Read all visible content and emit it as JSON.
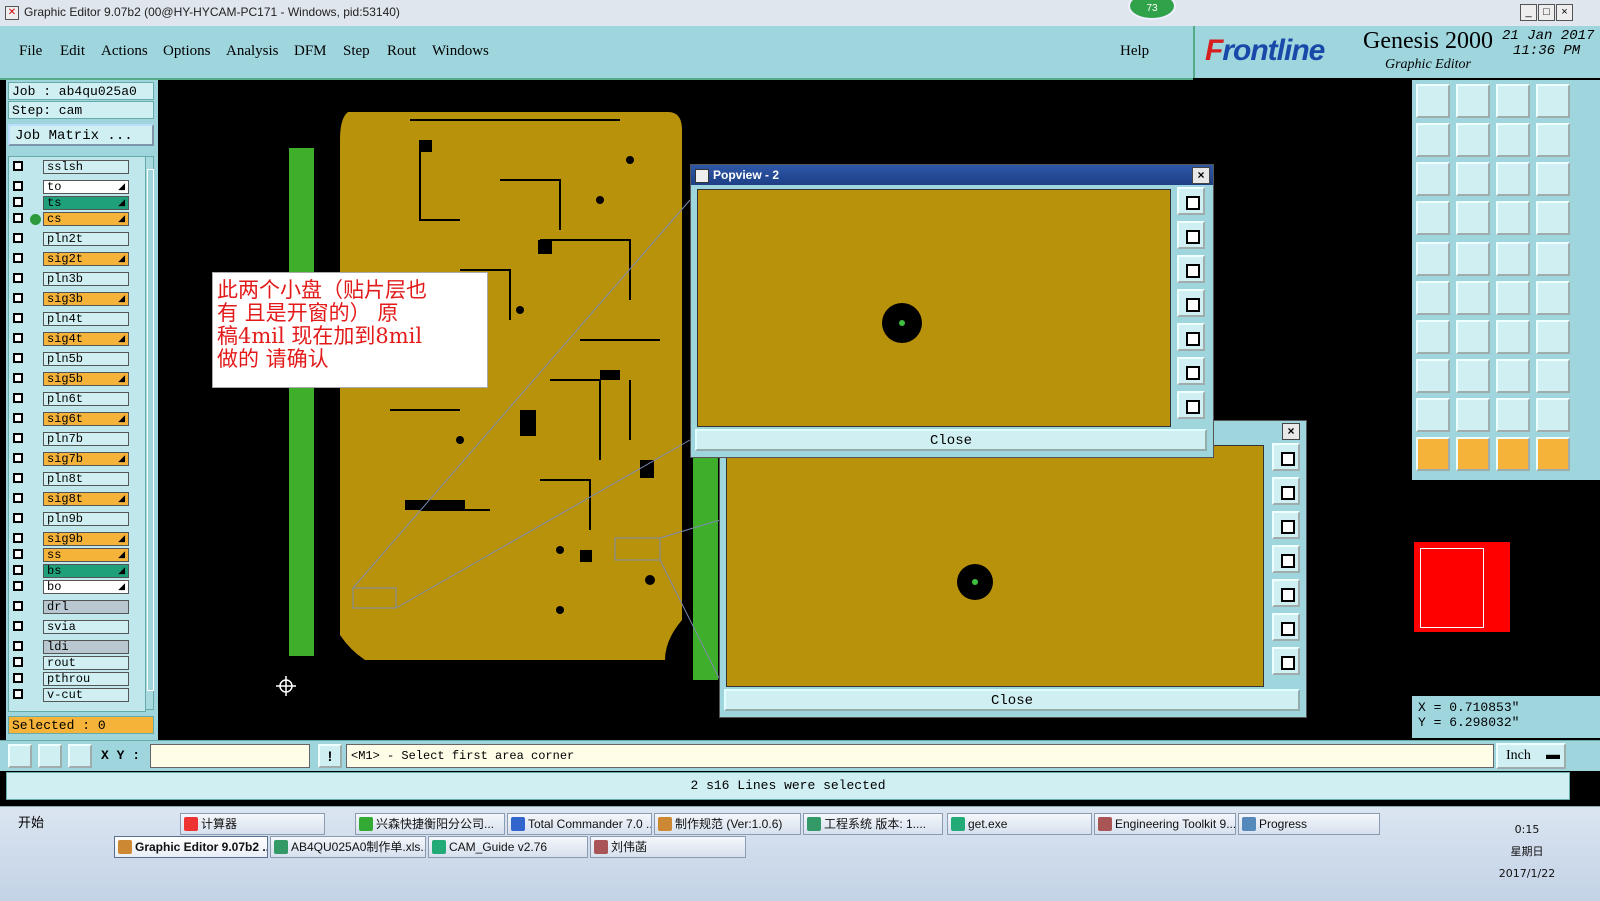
{
  "window": {
    "title": "Graphic Editor 9.07b2 (00@HY-HYCAM-PC171 - Windows, pid:53140)",
    "badge": "73",
    "controls": [
      "_",
      "□",
      "×"
    ]
  },
  "menu": {
    "items": [
      "File",
      "Edit",
      "Actions",
      "Options",
      "Analysis",
      "DFM",
      "Step",
      "Rout",
      "Windows"
    ],
    "help": "Help"
  },
  "brand": {
    "logo_prefix": "F",
    "logo_rest": "rontline",
    "product": "Genesis 2000",
    "subtitle": "Graphic Editor",
    "date": "21 Jan 2017",
    "time": "11:36 PM"
  },
  "job": {
    "job": "Job : ab4qu025a0",
    "step": "Step: cam",
    "matrix_button": "Job Matrix ..."
  },
  "layers": [
    {
      "name": "sslsh",
      "color": "#cfeff2",
      "arrow": false,
      "dot": false
    },
    {
      "name": "to",
      "color": "#ffffff",
      "arrow": true,
      "dot": false
    },
    {
      "name": "ts",
      "color": "#1fa07a",
      "arrow": true,
      "dot": false
    },
    {
      "name": "cs",
      "color": "#f5b33a",
      "arrow": true,
      "dot": true
    },
    {
      "name": "pln2t",
      "color": "#cfeff2",
      "arrow": false,
      "dot": false
    },
    {
      "name": "sig2t",
      "color": "#f5b33a",
      "arrow": true,
      "dot": false
    },
    {
      "name": "pln3b",
      "color": "#cfeff2",
      "arrow": false,
      "dot": false
    },
    {
      "name": "sig3b",
      "color": "#f5b33a",
      "arrow": true,
      "dot": false
    },
    {
      "name": "pln4t",
      "color": "#cfeff2",
      "arrow": false,
      "dot": false
    },
    {
      "name": "sig4t",
      "color": "#f5b33a",
      "arrow": true,
      "dot": false
    },
    {
      "name": "pln5b",
      "color": "#cfeff2",
      "arrow": false,
      "dot": false
    },
    {
      "name": "sig5b",
      "color": "#f5b33a",
      "arrow": true,
      "dot": false
    },
    {
      "name": "pln6t",
      "color": "#cfeff2",
      "arrow": false,
      "dot": false
    },
    {
      "name": "sig6t",
      "color": "#f5b33a",
      "arrow": true,
      "dot": false
    },
    {
      "name": "pln7b",
      "color": "#cfeff2",
      "arrow": false,
      "dot": false
    },
    {
      "name": "sig7b",
      "color": "#f5b33a",
      "arrow": true,
      "dot": false
    },
    {
      "name": "pln8t",
      "color": "#cfeff2",
      "arrow": false,
      "dot": false
    },
    {
      "name": "sig8t",
      "color": "#f5b33a",
      "arrow": true,
      "dot": false
    },
    {
      "name": "pln9b",
      "color": "#cfeff2",
      "arrow": false,
      "dot": false
    },
    {
      "name": "sig9b",
      "color": "#f5b33a",
      "arrow": true,
      "dot": false
    },
    {
      "name": "ss",
      "color": "#f5b33a",
      "arrow": true,
      "dot": false
    },
    {
      "name": "bs",
      "color": "#1fa07a",
      "arrow": true,
      "dot": false
    },
    {
      "name": "bo",
      "color": "#ffffff",
      "arrow": true,
      "dot": false
    },
    {
      "name": "drl",
      "color": "#b9c8d0",
      "arrow": false,
      "dot": false
    },
    {
      "name": "svia",
      "color": "#cfeff2",
      "arrow": false,
      "dot": false
    },
    {
      "name": "ldi",
      "color": "#b9c8d0",
      "arrow": false,
      "dot": false
    },
    {
      "name": "rout",
      "color": "#cfeff2",
      "arrow": false,
      "dot": false
    },
    {
      "name": "pthrou",
      "color": "#cfeff2",
      "arrow": false,
      "dot": false
    },
    {
      "name": "v-cut",
      "color": "#cfeff2",
      "arrow": false,
      "dot": false
    }
  ],
  "selected": "Selected : 0",
  "note": {
    "lines": [
      "此两个小盘（贴片层也",
      "有 且是开窗的）  原",
      "稿4mil  现在加到8mil",
      "做的  请确认"
    ]
  },
  "popview1": {
    "title": "Popview - 2",
    "close": "Close",
    "close_x": "×"
  },
  "popview2": {
    "close": "Close",
    "close_x": "×"
  },
  "coords": {
    "x": "X = 0.710853\"",
    "y": "Y = 6.298032\""
  },
  "command": {
    "xy_label": "X Y :",
    "xy_value": "",
    "warn": "!",
    "prompt": "<M1> - Select first area corner",
    "units": "Inch"
  },
  "status": "2 s16 Lines were selected",
  "taskbar": {
    "start": "开始",
    "row1": [
      "计算器",
      "兴森快捷衡阳分公司...",
      "Total Commander 7.0 ...",
      "制作规范 (Ver:1.0.6)",
      "工程系统  版本: 1....",
      "get.exe",
      "Engineering Toolkit 9....",
      "Progress"
    ],
    "row2": [
      "Graphic Editor 9.07b2 ...",
      "AB4QU025A0制作单.xls...",
      "CAM_Guide v2.76",
      "刘伟菡"
    ],
    "clock_time": "0:15",
    "clock_day": "星期日",
    "clock_date": "2017/1/22"
  },
  "colors": {
    "board": "#b8920a",
    "accent_panel": "#9fd6de",
    "note_text": "#e31a1a",
    "minimap": "#ff0000"
  }
}
